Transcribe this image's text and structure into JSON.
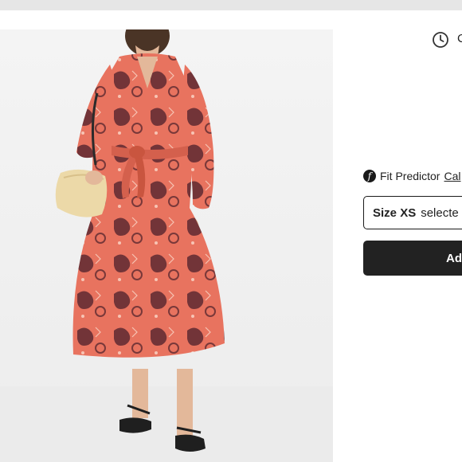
{
  "top_bar": {
    "text": ""
  },
  "product": {
    "image_alt": "Woman wearing a coral paisley print tiered midi dress with a belted waist, holding a straw bag and wearing black sandals",
    "colors": {
      "dress": "#e8735f",
      "print": "#4a1f2a",
      "bag": "#ecd9a8",
      "background": "#f3f3f3"
    }
  },
  "delivery": {
    "icon": "clock-icon",
    "text": "C"
  },
  "fit_predictor": {
    "icon": "fit-predictor-logo-icon",
    "logo_letter": "f",
    "label": "Fit Predictor",
    "link": "Cal"
  },
  "size_selector": {
    "prefix": "Size",
    "value": "XS",
    "status": "selecte"
  },
  "add_button": {
    "label": "Ad"
  }
}
